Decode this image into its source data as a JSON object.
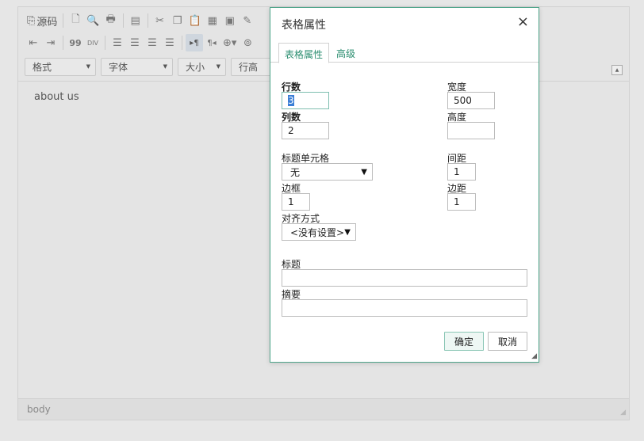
{
  "toolbar": {
    "source_label": "源码",
    "format_label": "格式",
    "font_label": "字体",
    "size_label": "大小",
    "lineheight_label": "行高",
    "blockquote_label": "99",
    "div_label": "DIV",
    "ltr_label": "▸¶",
    "rtl_label": "¶◂"
  },
  "editor": {
    "content": "about us",
    "status_path": "body"
  },
  "dialog": {
    "title": "表格属性",
    "close_glyph": "×",
    "tabs": [
      {
        "label": "表格属性"
      },
      {
        "label": "高级"
      }
    ],
    "rows": {
      "label": "行数",
      "value": "3"
    },
    "cols": {
      "label": "列数",
      "value": "2"
    },
    "width": {
      "label": "宽度",
      "value": "500"
    },
    "height": {
      "label": "高度",
      "value": ""
    },
    "header_cells": {
      "label": "标题单元格",
      "value": "无"
    },
    "spacing": {
      "label": "间距",
      "value": "1"
    },
    "border": {
      "label": "边框",
      "value": "1"
    },
    "padding": {
      "label": "边距",
      "value": "1"
    },
    "align": {
      "label": "对齐方式",
      "value": "<没有设置>"
    },
    "caption": {
      "label": "标题",
      "value": ""
    },
    "summary": {
      "label": "摘要",
      "value": ""
    },
    "ok_label": "确定",
    "cancel_label": "取消"
  },
  "colors": {
    "accent": "#2a8d6f",
    "dialog_border": "#4fa58a"
  }
}
